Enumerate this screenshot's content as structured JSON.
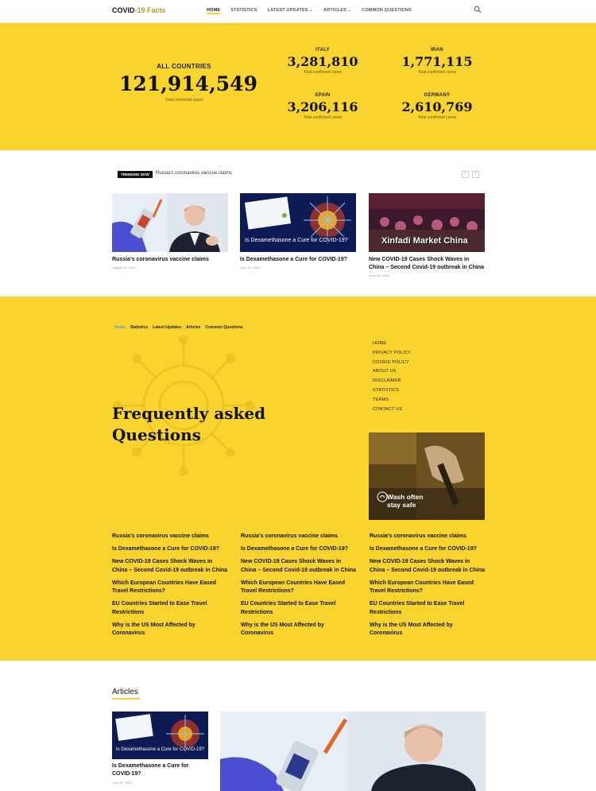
{
  "brand": {
    "name": "COVID",
    "accent": "-19 Facts"
  },
  "nav": {
    "home": "HOME",
    "statistics": "STATISTICS",
    "latest_updates": "LATEST UPDATES",
    "articles": "ARTICLES",
    "common_questions": "COMMON QUESTIONS"
  },
  "stats": {
    "all": {
      "label": "ALL COUNTRIES",
      "value": "121,914,549",
      "sub": "Total confirmed cases"
    },
    "countries": [
      {
        "label": "ITALY",
        "value": "3,281,810",
        "sub": "Total confirmed cases"
      },
      {
        "label": "IRAN",
        "value": "1,771,115",
        "sub": "Total confirmed cases"
      },
      {
        "label": "SPAIN",
        "value": "3,206,116",
        "sub": "Total confirmed cases"
      },
      {
        "label": "GERMANY",
        "value": "2,610,769",
        "sub": "Total confirmed cases"
      }
    ]
  },
  "trending": {
    "badge": "TRENDING NOW",
    "text": "Russia's coronavirus vaccine claims",
    "prev": "‹",
    "next": "›"
  },
  "cards": [
    {
      "title": "Russia's coronavirus vaccine claims",
      "date": "August 26, 2020"
    },
    {
      "title": "Is Dexamethasone a Cure for COVID-19?",
      "date": "June 20, 2020",
      "overlay": "Is Dexamethasone a Cure for COVID-19?"
    },
    {
      "title": "New COVID-19 Cases Shock Waves in China – Second Covid-19 outbreak in China",
      "date": "June 18, 2020",
      "overlay": "Xinfadi Market China"
    }
  ],
  "faq": {
    "breadcrumbs": [
      "Home",
      "Statistics",
      "Latest Updates",
      "Articles",
      "Common Questions"
    ],
    "heading": "Frequently asked Questions",
    "footer_links": [
      "HOME",
      "PRIVACY POLICY",
      "COOKIE POLICY",
      "ABOUT US",
      "DISCLAIMER",
      "STATISTICS",
      "TERMS",
      "CONTACT US"
    ],
    "wash_text": "Wash often stay safe",
    "questions": [
      "Russia's coronavirus vaccine claims",
      "Is Dexamethasone a Cure for COVID-19?",
      "New COVID-19 Cases Shock Waves in China – Second Covid-19 outbreak in China",
      "Which European Countries Have Eased Travel Restrictions?",
      "EU Countries Started to Ease Travel Restrictions",
      "Why is the US Most Affected by Coronavirus"
    ]
  },
  "articles": {
    "heading": "Articles",
    "first": {
      "title": "Is Dexamethasone a Cure for COVID-19?",
      "date": "June 20, 2020",
      "overlay": "Is Dexamethasone a Cure for COVID-19?"
    }
  },
  "colors": {
    "accent": "#f9d42e",
    "dark": "#111111",
    "link_active": "#4aa0e0"
  }
}
